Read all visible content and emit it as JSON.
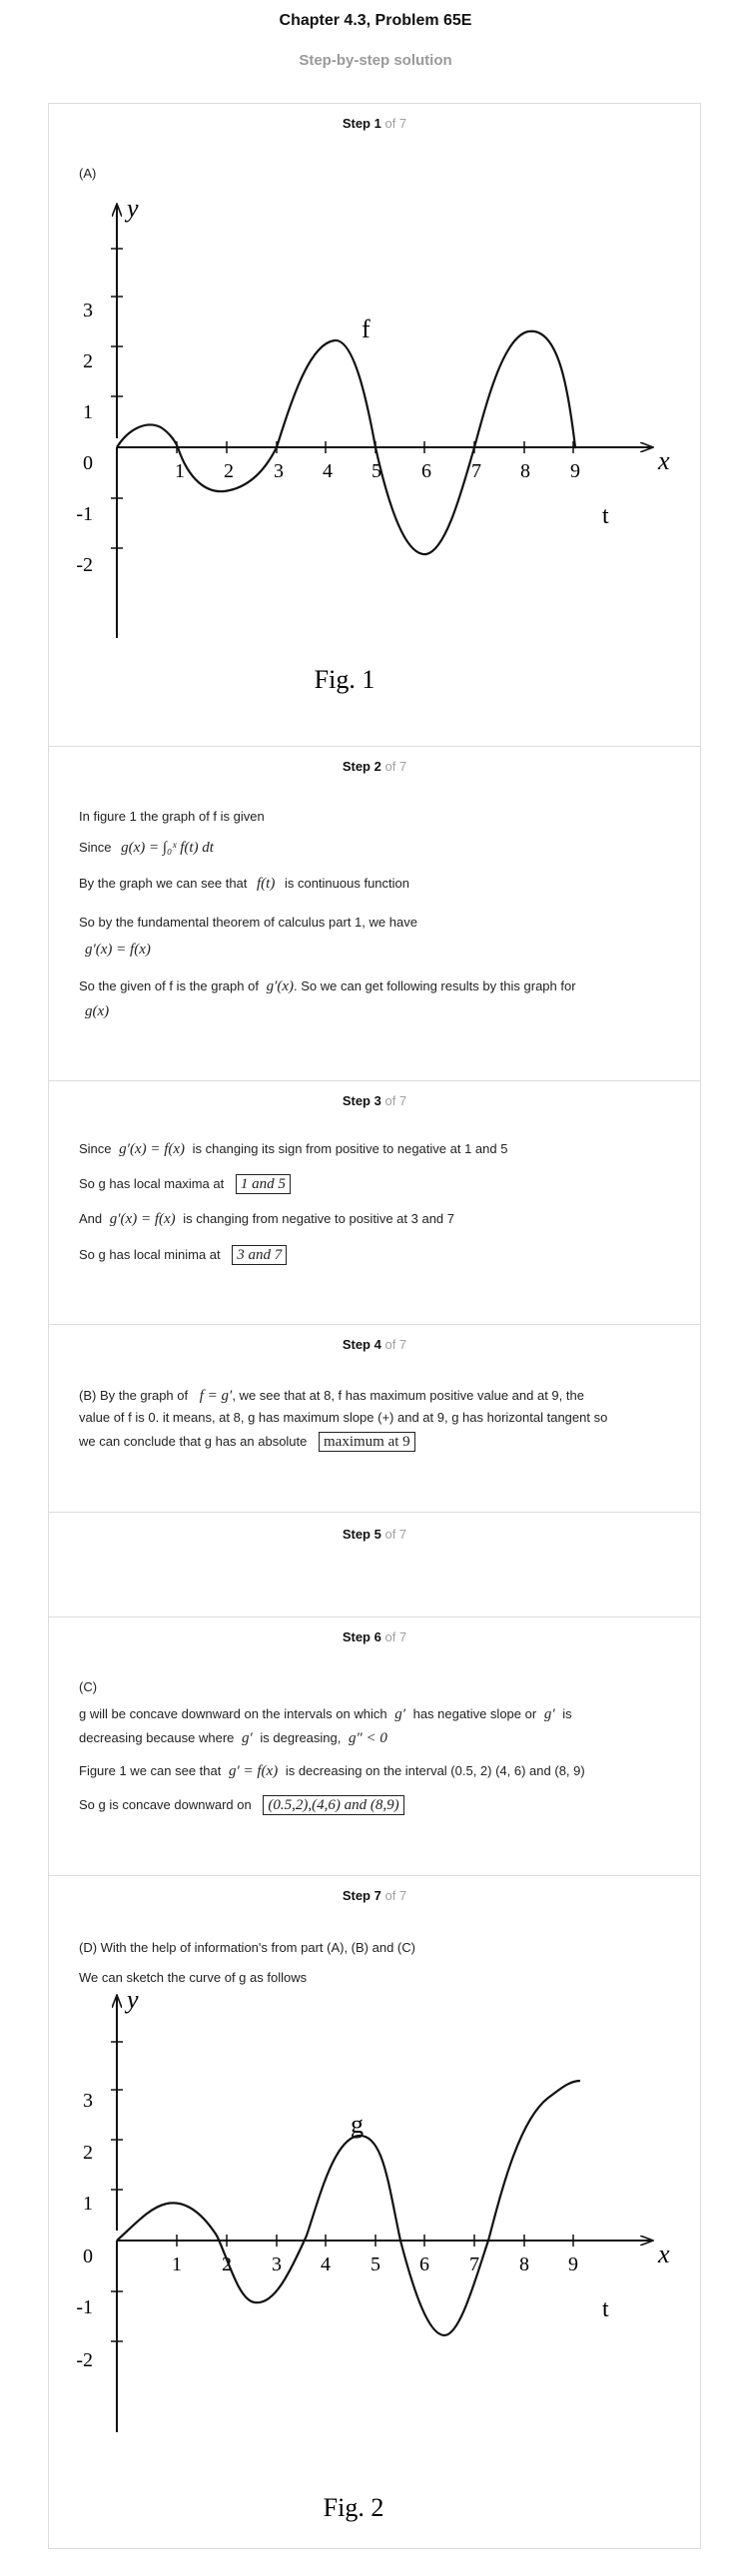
{
  "header": {
    "title": "Chapter 4.3, Problem 65E",
    "subtitle": "Step-by-step solution"
  },
  "steps": [
    {
      "num": "Step 1",
      "of": "of 7"
    },
    {
      "num": "Step 2",
      "of": "of 7"
    },
    {
      "num": "Step 3",
      "of": "of 7"
    },
    {
      "num": "Step 4",
      "of": "of 7"
    },
    {
      "num": "Step 5",
      "of": "of 7"
    },
    {
      "num": "Step 6",
      "of": "of 7"
    },
    {
      "num": "Step 7",
      "of": "of 7"
    }
  ],
  "step1": {
    "part": "(A)",
    "fig": {
      "y_label": "y",
      "x_label": "x",
      "t_label": "t",
      "curve_label": "f",
      "x_ticks": [
        "1",
        "2",
        "3",
        "4",
        "5",
        "6",
        "7",
        "8",
        "9"
      ],
      "y_ticks": [
        "3",
        "2",
        "1",
        "0",
        "-1",
        "-2"
      ],
      "caption": "Fig. 1"
    }
  },
  "step2": {
    "l1": "In figure 1 the graph of f is given",
    "l2a": "Since",
    "l2m": "g(x) = ∫₀ˣ f(t) dt",
    "l3a": "By the graph we can see that",
    "l3m": "f(t)",
    "l3b": "is continuous function",
    "l4": "So by the fundamental theorem of calculus part 1, we have",
    "l5m": "g′(x) = f(x)",
    "l6a": "So the given of f is the graph of",
    "l6m": "g′(x)",
    "l6b": ". So we can get following results by this graph for",
    "l7m": "g(x)"
  },
  "step3": {
    "l1a": "Since",
    "l1m": "g′(x) = f(x)",
    "l1b": "is changing its sign from positive to negative at 1 and 5",
    "l2a": "So g has local maxima at",
    "l2box": "1 and 5",
    "l3a": "And",
    "l3m": "g′(x) = f(x)",
    "l3b": "is changing from negative to positive at 3 and 7",
    "l4a": "So g has local minima at",
    "l4box": "3 and 7"
  },
  "step4": {
    "l1a": "(B) By the graph of",
    "l1m": "f = g′",
    "l1b": ", we see that at 8, f has maximum positive value and at 9, the",
    "l2": "value of f is 0. it means, at 8, g has maximum slope (+) and at 9, g has horizontal tangent so",
    "l3a": "we can conclude that g has an absolute",
    "l3box": "maximum at 9"
  },
  "step6": {
    "part": "(C)",
    "l1a": "g will be concave downward on the intervals on which",
    "l1m1": "g′",
    "l1b": "has negative slope or",
    "l1m2": "g′",
    "l1c": "is",
    "l2a": "decreasing because where",
    "l2m1": "g′",
    "l2b": "is degreasing,",
    "l2m2": "g″ < 0",
    "l3a": "Figure 1 we can see that",
    "l3m": "g′ = f(x)",
    "l3b": "is decreasing on the interval (0.5, 2) (4, 6) and (8, 9)",
    "l4a": "So g is concave downward on",
    "l4box": "(0.5,2),(4,6) and (8,9)"
  },
  "step7": {
    "l1": "(D) With the help of information's from part (A), (B) and (C)",
    "l2": "We can sketch the curve of g as follows",
    "fig": {
      "y_label": "y",
      "x_label": "x",
      "t_label": "t",
      "curve_label": "g",
      "x_ticks": [
        "1",
        "2",
        "3",
        "4",
        "5",
        "6",
        "7",
        "8",
        "9"
      ],
      "y_ticks": [
        "3",
        "2",
        "1",
        "0",
        "-1",
        "-2"
      ],
      "caption": "Fig. 2"
    }
  }
}
